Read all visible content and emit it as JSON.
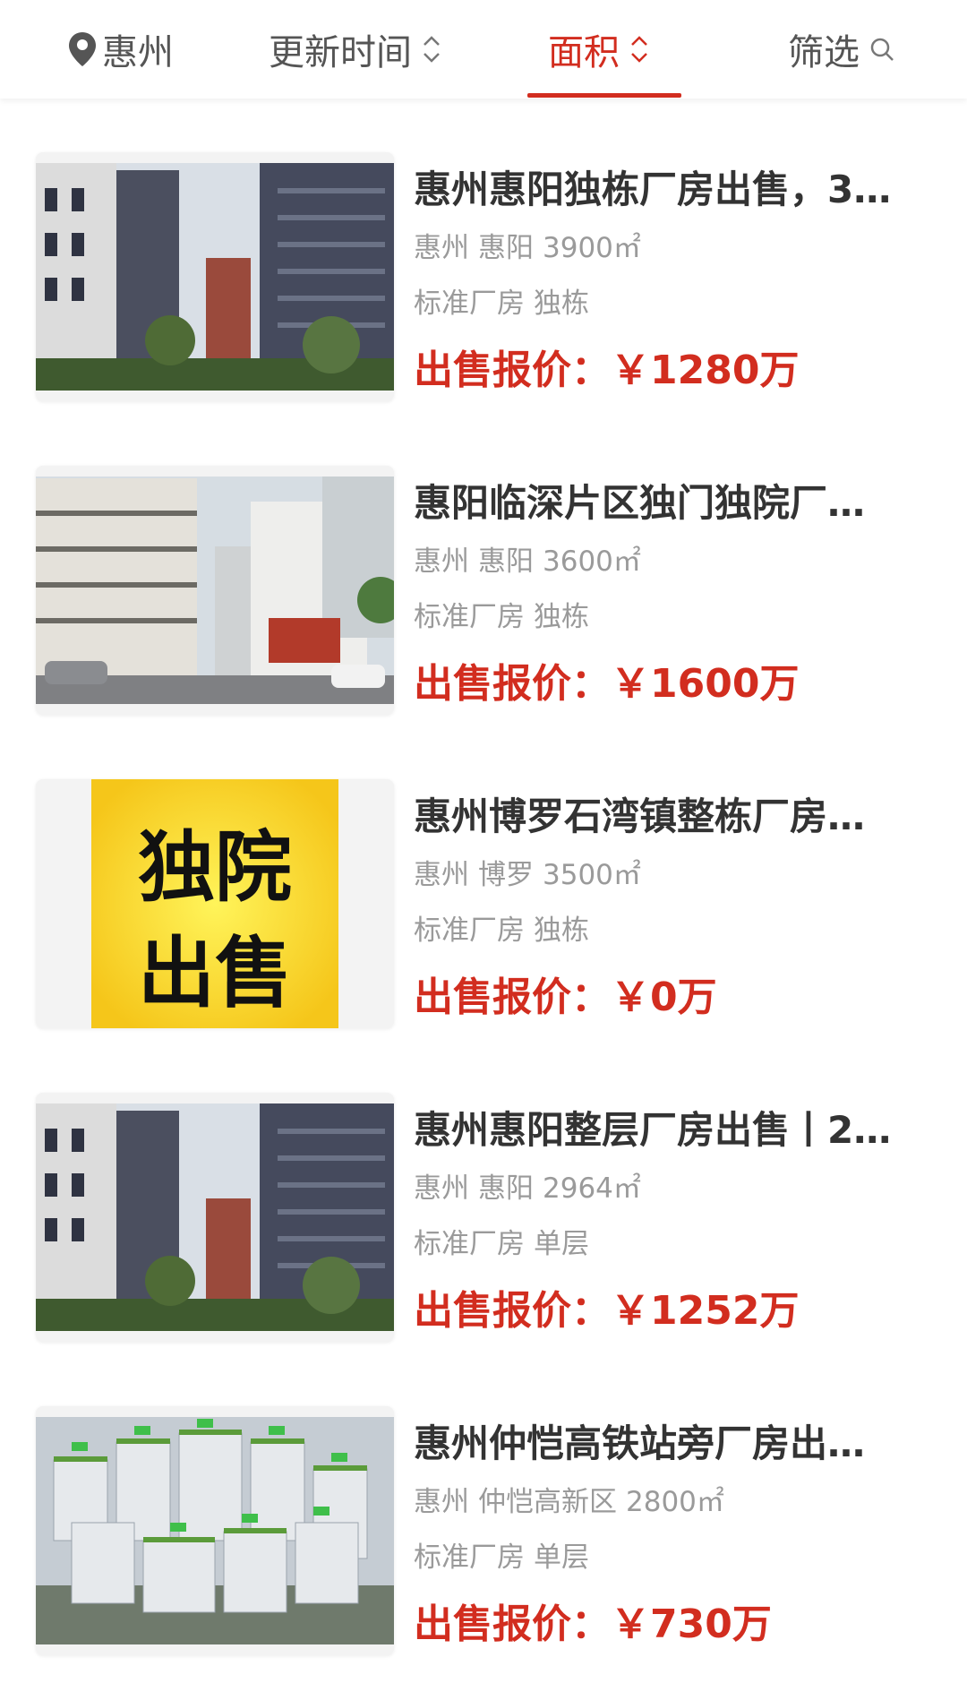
{
  "topbar": {
    "city": "惠州",
    "sort_update": "更新时间",
    "sort_area": "面积",
    "filter": "筛选",
    "accent_color": "#d22d1f"
  },
  "listings": [
    {
      "title": "惠州惠阳独栋厂房出售，3…",
      "city": "惠州",
      "district": "惠阳",
      "area": "3900㎡",
      "type": "标准厂房",
      "structure": "独栋",
      "price_label": "出售报价：",
      "price": "￥1280万",
      "image": "building-photo"
    },
    {
      "title": "惠阳临深片区独门独院厂…",
      "city": "惠州",
      "district": "惠阳",
      "area": "3600㎡",
      "type": "标准厂房",
      "structure": "独栋",
      "price_label": "出售报价：",
      "price": "￥1600万",
      "image": "factory-yard-photo"
    },
    {
      "title": "惠州博罗石湾镇整栋厂房…",
      "city": "惠州",
      "district": "博罗",
      "area": "3500㎡",
      "type": "标准厂房",
      "structure": "独栋",
      "price_label": "出售报价：",
      "price": "￥0万",
      "image": "sale-sign",
      "sign_line1": "独院",
      "sign_line2": "出售"
    },
    {
      "title": "惠州惠阳整层厂房出售丨2…",
      "city": "惠州",
      "district": "惠阳",
      "area": "2964㎡",
      "type": "标准厂房",
      "structure": "单层",
      "price_label": "出售报价：",
      "price": "￥1252万",
      "image": "building-photo"
    },
    {
      "title": "惠州仲恺高铁站旁厂房出…",
      "city": "惠州",
      "district": "仲恺高新区",
      "area": "2800㎡",
      "type": "标准厂房",
      "structure": "单层",
      "price_label": "出售报价：",
      "price": "￥730万",
      "image": "aerial-rendering"
    }
  ]
}
